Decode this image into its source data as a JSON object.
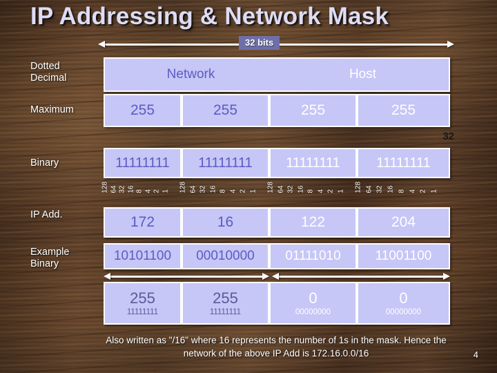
{
  "slide": {
    "title": "IP Addressing & Network Mask",
    "page_number": "4",
    "colors": {
      "cell_fill": "#c6c6f7",
      "network_text": "#5b5bc4",
      "host_text": "#ffffff",
      "label_box": "#6f6fa8",
      "background": "#4b3324"
    }
  },
  "bits_ruler": {
    "label": "32 bits"
  },
  "bit_count_label": "32",
  "row_labels": {
    "dotted_decimal": "Dotted\nDecimal",
    "maximum": "Maximum",
    "binary": "Binary",
    "ip_add": "IP Add.",
    "example_binary": "Example\nBinary"
  },
  "header_row": {
    "network": "Network",
    "host": "Host"
  },
  "maximum_row": {
    "values": [
      "255",
      "255",
      "255",
      "255"
    ],
    "kinds": [
      "net",
      "net",
      "host",
      "host"
    ]
  },
  "binary_row": {
    "values": [
      "11111111",
      "11111111",
      "11111111",
      "11111111"
    ],
    "kinds": [
      "net",
      "net",
      "host",
      "host"
    ]
  },
  "bit_weights": [
    "128",
    "64",
    "32",
    "16",
    "8",
    "4",
    "2",
    "1"
  ],
  "ip_address_row": {
    "values": [
      "172",
      "16",
      "122",
      "204"
    ],
    "kinds": [
      "net",
      "net",
      "host",
      "host"
    ]
  },
  "example_binary_row": {
    "values": [
      "10101100",
      "00010000",
      "01111010",
      "11001100"
    ],
    "kinds": [
      "net",
      "net",
      "host",
      "host"
    ]
  },
  "mask_row": {
    "decimal": [
      "255",
      "255",
      "0",
      "0"
    ],
    "binary": [
      "11111111",
      "11111111",
      "00000000",
      "00000000"
    ],
    "kinds": [
      "net",
      "net",
      "host",
      "host"
    ]
  },
  "footnote": "Also written as \"/16\" where 16 represents the number of 1s in the mask. Hence  the network of the above IP Add is 172.16.0.0/16"
}
